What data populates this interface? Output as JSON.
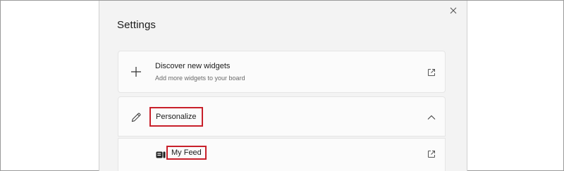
{
  "panel": {
    "title": "Settings"
  },
  "discover": {
    "title": "Discover new widgets",
    "subtitle": "Add more widgets to your board",
    "icon": "plus-icon",
    "action_icon": "external-link-icon"
  },
  "personalize": {
    "label": "Personalize",
    "icon": "pencil-icon",
    "expand_icon": "chevron-up-icon"
  },
  "my_feed": {
    "label": "My Feed",
    "icon": "feed-icon",
    "action_icon": "external-link-icon"
  },
  "colors": {
    "highlight": "#c8202a",
    "panel_bg": "#f3f3f3",
    "card_bg": "#fbfbfb"
  }
}
